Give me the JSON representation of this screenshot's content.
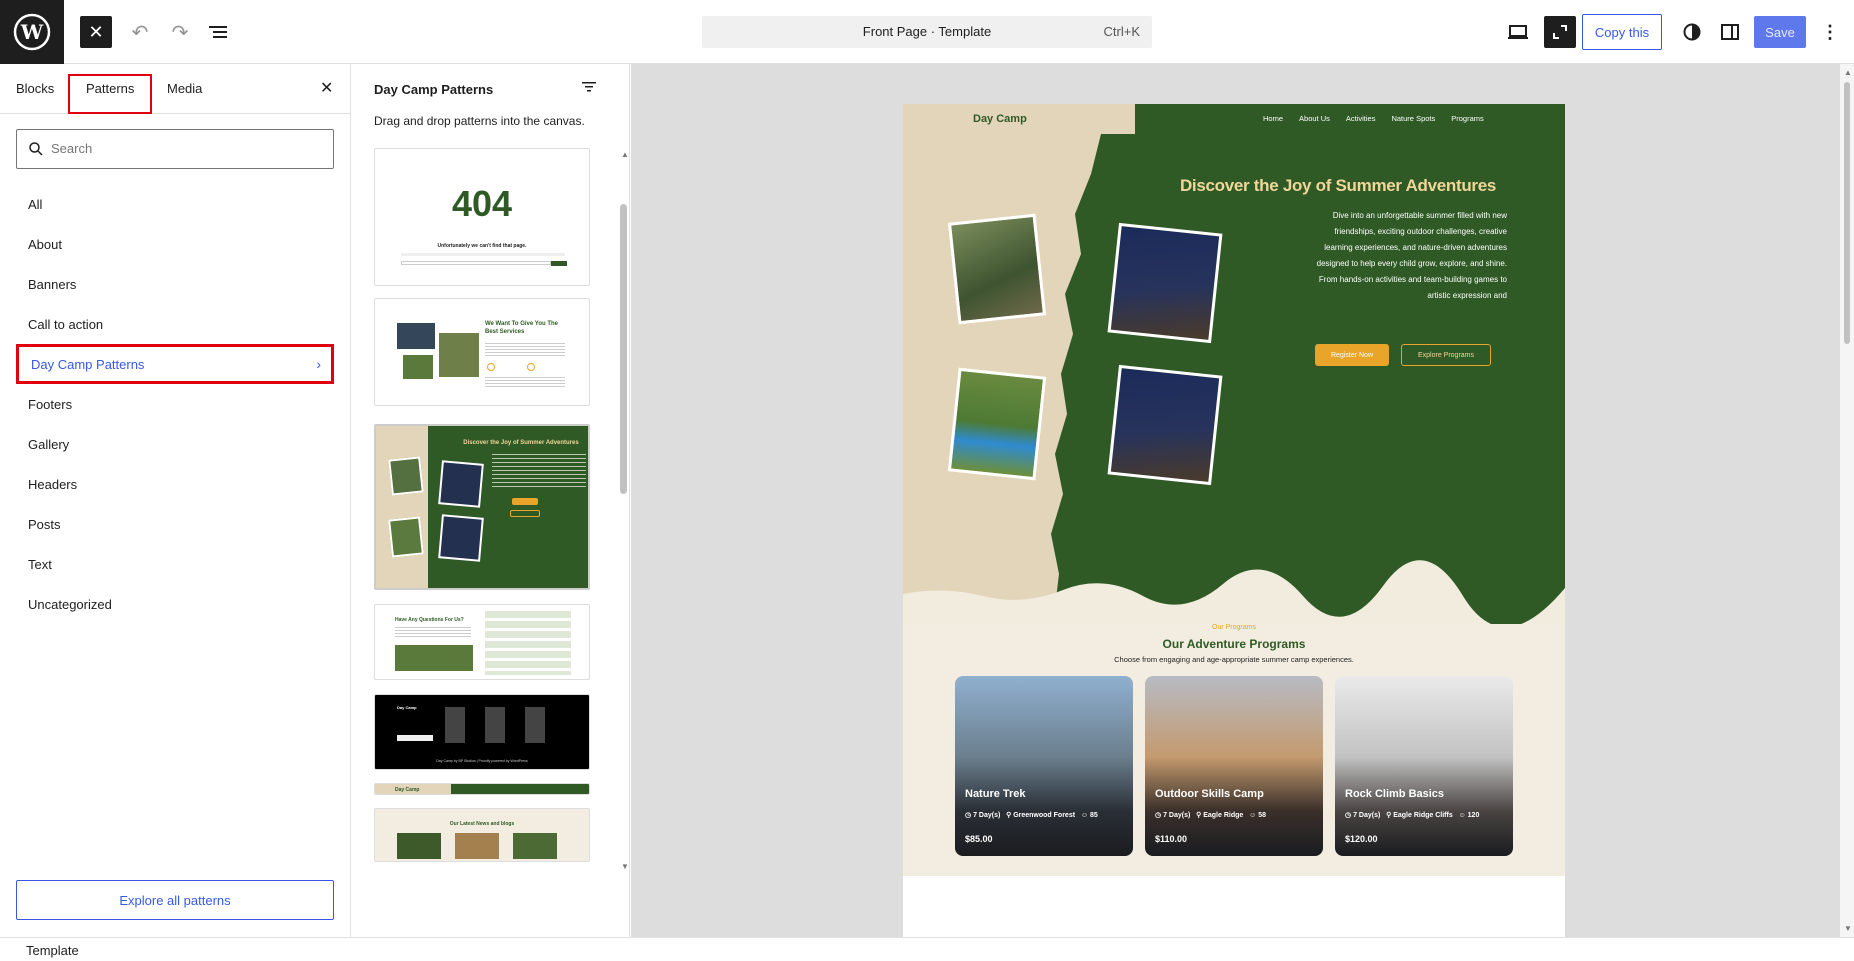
{
  "topbar": {
    "command_title": "Front Page · Template",
    "command_shortcut": "Ctrl+K",
    "copy_label": "Copy this",
    "save_label": "Save"
  },
  "sidebar": {
    "tabs": [
      "Blocks",
      "Patterns",
      "Media"
    ],
    "search_placeholder": "Search",
    "categories": [
      "All",
      "About",
      "Banners",
      "Call to action",
      "Day Camp Patterns",
      "Footers",
      "Gallery",
      "Headers",
      "Posts",
      "Text",
      "Uncategorized"
    ],
    "explore_label": "Explore all patterns"
  },
  "patterns_panel": {
    "title": "Day Camp Patterns",
    "description": "Drag and drop patterns into the canvas.",
    "thumbs": {
      "p404_title": "404",
      "p404_sub": "Unfortunately we can't find that page.",
      "services_title": "We Want To Give You The Best Services",
      "hero_title": "Discover the Joy of Summer Adventures",
      "faq_title": "Have Any Questions For Us?",
      "footer_brand": "Day Camp",
      "footer_copy": "Day Camp by BP Studios | Proudly powered by WordPress",
      "header_brand": "Day Camp",
      "blog_title": "Our Latest News and blogs"
    }
  },
  "preview": {
    "brand": "Day Camp",
    "nav_items": [
      "Home",
      "About Us",
      "Activities",
      "Nature Spots",
      "Programs"
    ],
    "hero_title": "Discover the Joy of Summer Adventures",
    "hero_text": "Dive into an unforgettable summer filled with new friendships, exciting outdoor challenges, creative learning experiences, and nature-driven adventures designed to help every child grow, explore, and shine. From hands-on activities and team-building games to artistic expression and",
    "register_label": "Register Now",
    "explore_label": "Explore Programs",
    "programs_kicker": "Our Programs",
    "programs_title": "Our Adventure Programs",
    "programs_sub": "Choose from engaging and age-appropriate summer camp experiences.",
    "cards": [
      {
        "name": "Nature Trek",
        "days": "7 Day(s)",
        "place": "Greenwood Forest",
        "count": "85",
        "price": "$85.00"
      },
      {
        "name": "Outdoor Skills Camp",
        "days": "7 Day(s)",
        "place": "Eagle Ridge",
        "count": "58",
        "price": "$110.00"
      },
      {
        "name": "Rock Climb Basics",
        "days": "7 Day(s)",
        "place": "Eagle Ridge Cliffs",
        "count": "120",
        "price": "$120.00"
      }
    ]
  },
  "footer": {
    "breadcrumb": "Template"
  },
  "colors": {
    "accent": "#3858e9",
    "highlight": "#e00010",
    "camp_green": "#2f5a25",
    "camp_beige": "#e2d5b9",
    "camp_orange": "#e8a52a"
  }
}
